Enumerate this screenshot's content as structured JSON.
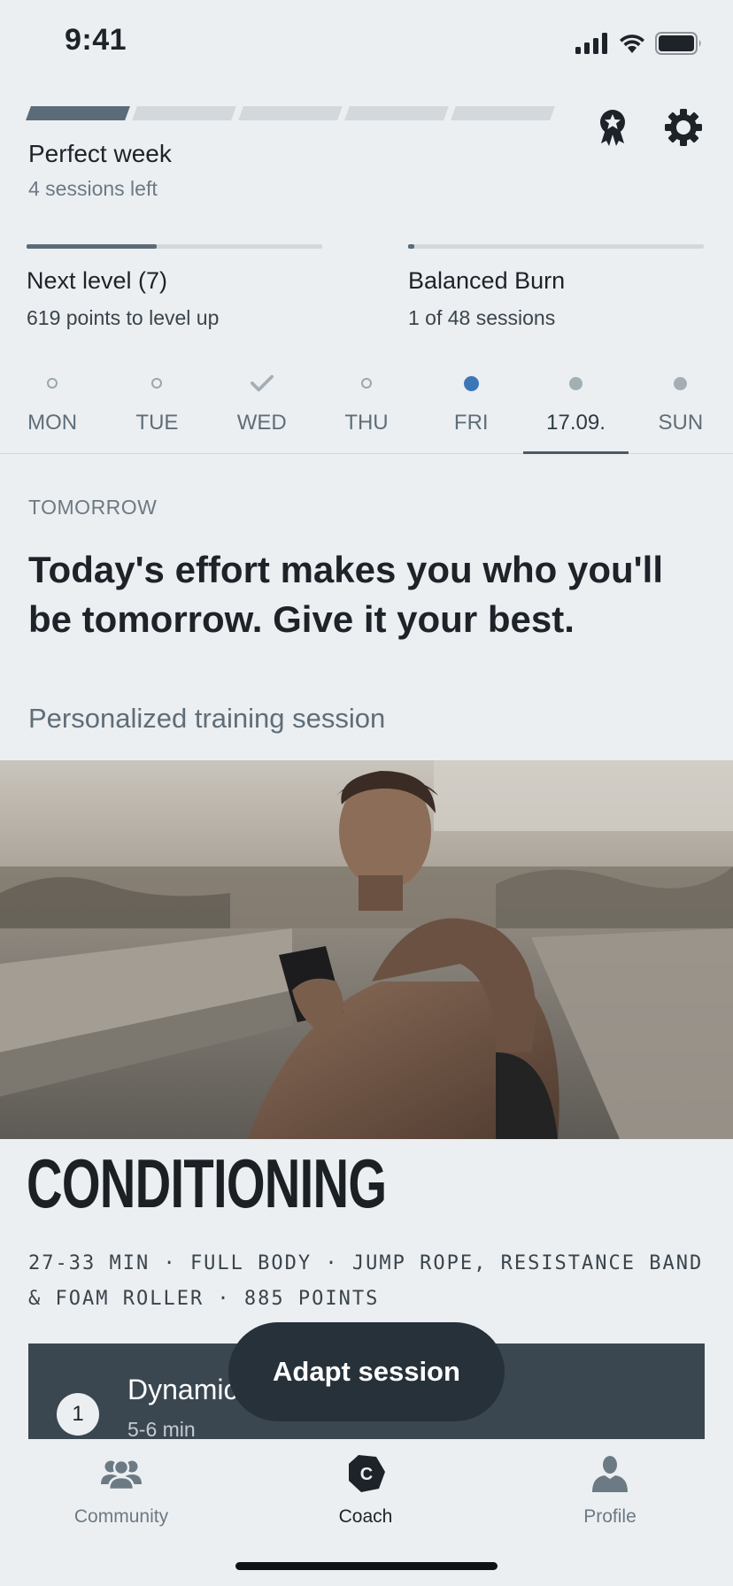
{
  "status": {
    "time": "9:41"
  },
  "perfect_week": {
    "title": "Perfect week",
    "subtitle": "4 sessions left",
    "segments_total": 5,
    "segments_done": 1
  },
  "level": {
    "title": "Next level (7)",
    "subtitle": "619 points to level up",
    "progress": 0.44
  },
  "program": {
    "title": "Balanced Burn",
    "subtitle": "1 of 48 sessions",
    "progress": 0.02
  },
  "days": [
    {
      "label": "MON",
      "state": "open"
    },
    {
      "label": "TUE",
      "state": "open"
    },
    {
      "label": "WED",
      "state": "done"
    },
    {
      "label": "THU",
      "state": "open"
    },
    {
      "label": "FRI",
      "state": "today"
    },
    {
      "label": "17.09.",
      "state": "planned-selected"
    },
    {
      "label": "SUN",
      "state": "planned"
    }
  ],
  "day_header": "TOMORROW",
  "quote": "Today's effort makes you who you'll be tomorrow. Give it your best.",
  "section_label": "Personalized training session",
  "session": {
    "title": "CONDITIONING",
    "meta": "27-33 MIN · FULL BODY · JUMP ROPE, RESISTANCE BAND & FOAM ROLLER · 885 POINTS",
    "first_exercise": {
      "number": "1",
      "title": "Dynamic",
      "duration": "5-6 min"
    }
  },
  "adapt_button": "Adapt session",
  "tabs": [
    {
      "label": "Community",
      "icon": "community-icon"
    },
    {
      "label": "Coach",
      "icon": "coach-icon",
      "badge": "C"
    },
    {
      "label": "Profile",
      "icon": "profile-icon"
    }
  ],
  "colors": {
    "accent_today": "#3d76b8",
    "progress": "#5b6b77",
    "card": "#3b4750",
    "button": "#27313a"
  }
}
